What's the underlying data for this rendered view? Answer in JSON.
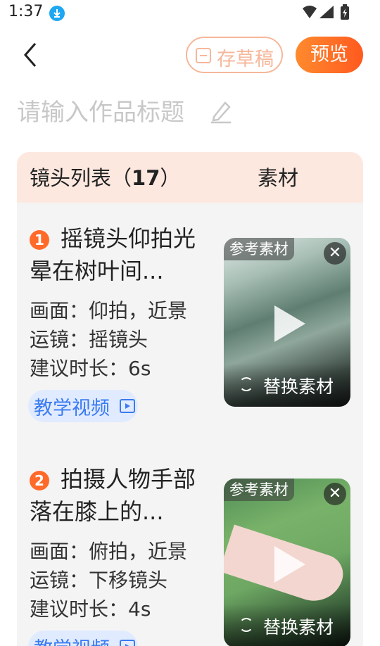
{
  "status_bar": {
    "time": "1:37",
    "icons": [
      "download-icon",
      "wifi-icon",
      "signal-icon",
      "battery-icon"
    ]
  },
  "toolbar": {
    "draft_label": "存草稿",
    "preview_label": "预览"
  },
  "title_input": {
    "placeholder": "请输入作品标题"
  },
  "shot_list": {
    "header_label": "镜头列表（",
    "header_count": "17",
    "header_close": "）",
    "material_header": "素材",
    "items": [
      {
        "number": "1",
        "title": "摇镜头仰拍光晕在树叶间...",
        "scene": "画面：仰拍，近景",
        "camera": "运镜：摇镜头",
        "duration": "建议时长：6s",
        "tutorial_label": "教学视频",
        "tag": "参考素材",
        "replace_label": "替换素材"
      },
      {
        "number": "2",
        "title": "拍摄人物手部落在膝上的...",
        "scene": "画面：俯拍，近景",
        "camera": "运镜：下移镜头",
        "duration": "建议时长：4s",
        "tutorial_label": "教学视频",
        "tag": "参考素材",
        "replace_label": "替换素材"
      }
    ]
  },
  "colors": {
    "accent": "#ff6a2a",
    "header_bg": "#fde8df",
    "link_blue": "#3a7bf0"
  }
}
